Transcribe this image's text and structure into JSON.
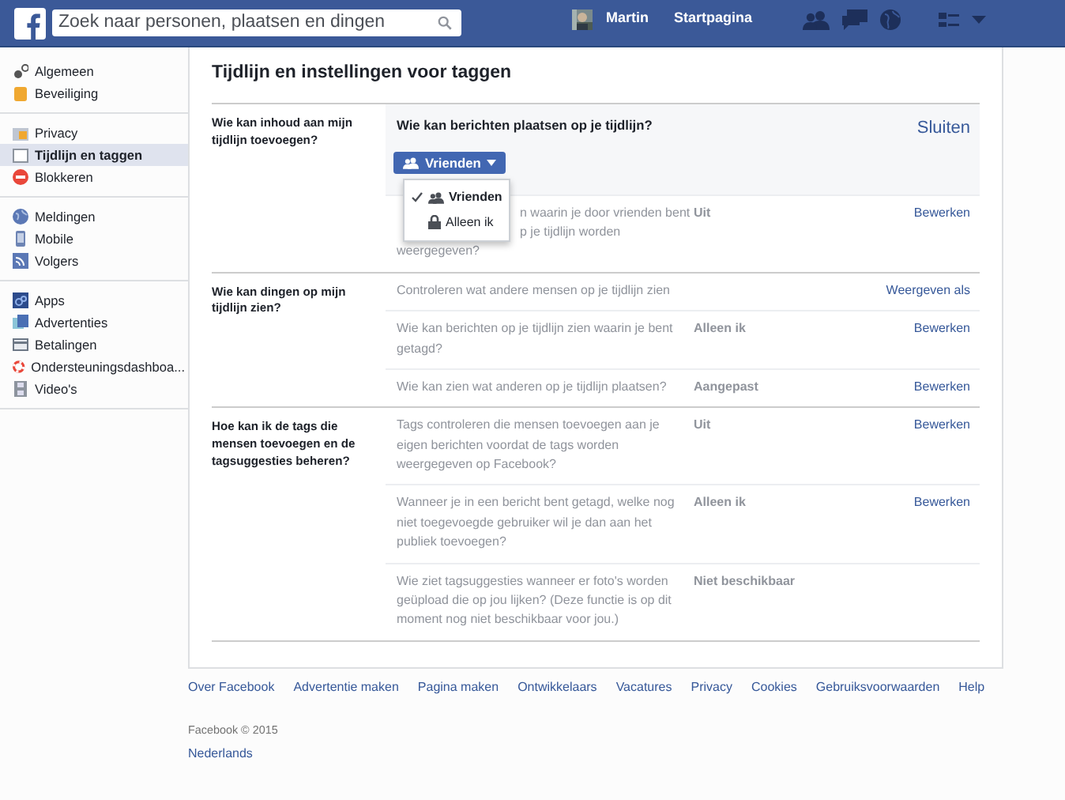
{
  "topbar": {
    "search": {
      "placeholder": "Zoek naar personen, plaatsen en dingen"
    },
    "user": "Martin",
    "home": "Startpagina"
  },
  "sidebar": {
    "groups": [
      [
        {
          "label": "Algemeen",
          "selected": false
        },
        {
          "label": "Beveiliging",
          "selected": false
        }
      ],
      [
        {
          "label": "Privacy",
          "selected": false
        },
        {
          "label": "Tijdlijn en taggen",
          "selected": true
        },
        {
          "label": "Blokkeren",
          "selected": false
        }
      ],
      [
        {
          "label": "Meldingen",
          "selected": false
        },
        {
          "label": "Mobile",
          "selected": false
        },
        {
          "label": "Volgers",
          "selected": false
        }
      ],
      [
        {
          "label": "Apps",
          "selected": false
        },
        {
          "label": "Advertenties",
          "selected": false
        },
        {
          "label": "Betalingen",
          "selected": false
        },
        {
          "label": "Ondersteuningsdashboa...",
          "selected": false
        },
        {
          "label": "Video's",
          "selected": false
        }
      ]
    ]
  },
  "page": {
    "title": "Tijdlijn en instellingen voor taggen",
    "sections": [
      {
        "label": "Wie kan inhoud aan mijn tijdlijn toevoegen?",
        "rows": [
          {
            "kind": "editor",
            "question": "Wie kan berichten plaatsen op je tijdlijn?",
            "action": "Sluiten",
            "dropdown": {
              "label": "Vrienden",
              "options": [
                {
                  "label": "Vrienden",
                  "selected": true
                },
                {
                  "label": "Alleen ik",
                  "selected": false
                }
              ]
            }
          },
          {
            "kind": "covered",
            "fragments": [
              "n waarin je door vrienden bent",
              "p je tijdlijn worden",
              "weergegeven?"
            ],
            "value": "Uit",
            "action": "Bewerken"
          }
        ]
      },
      {
        "label": "Wie kan dingen op mijn tijdlijn zien?",
        "rows": [
          {
            "kind": "setting",
            "text": "Controleren wat andere mensen op je tijdlijn zien",
            "action": "Weergeven als"
          },
          {
            "kind": "setting",
            "text": "Wie kan berichten op je tijdlijn zien waarin je bent getagd?",
            "value": "Alleen ik",
            "action": "Bewerken"
          },
          {
            "kind": "setting",
            "text": "Wie kan zien wat anderen op je tijdlijn plaatsen?",
            "value": "Aangepast",
            "action": "Bewerken"
          }
        ]
      },
      {
        "label": "Hoe kan ik de tags die mensen toevoegen en de tagsuggesties beheren?",
        "rows": [
          {
            "kind": "setting",
            "text": "Tags controleren die mensen toevoegen aan je eigen berichten voordat de tags worden weergegeven op Facebook?",
            "value": "Uit",
            "action": "Bewerken"
          },
          {
            "kind": "setting",
            "text": "Wanneer je in een bericht bent getagd, welke nog niet toegevoegde gebruiker wil je dan aan het publiek toevoegen?",
            "value": "Alleen ik",
            "action": "Bewerken"
          },
          {
            "kind": "setting",
            "text": "Wie ziet tagsuggesties wanneer er foto's worden geüpload die op jou lijken? (Deze functie is op dit moment nog niet beschikbaar voor jou.)",
            "value": "Niet beschikbaar"
          }
        ]
      }
    ]
  },
  "footer": {
    "links": [
      "Over Facebook",
      "Advertentie maken",
      "Pagina maken",
      "Ontwikkelaars",
      "Vacatures",
      "Privacy",
      "Cookies",
      "Gebruiksvoorwaarden",
      "Help"
    ],
    "copyright": "Facebook © 2015",
    "language": "Nederlands"
  }
}
